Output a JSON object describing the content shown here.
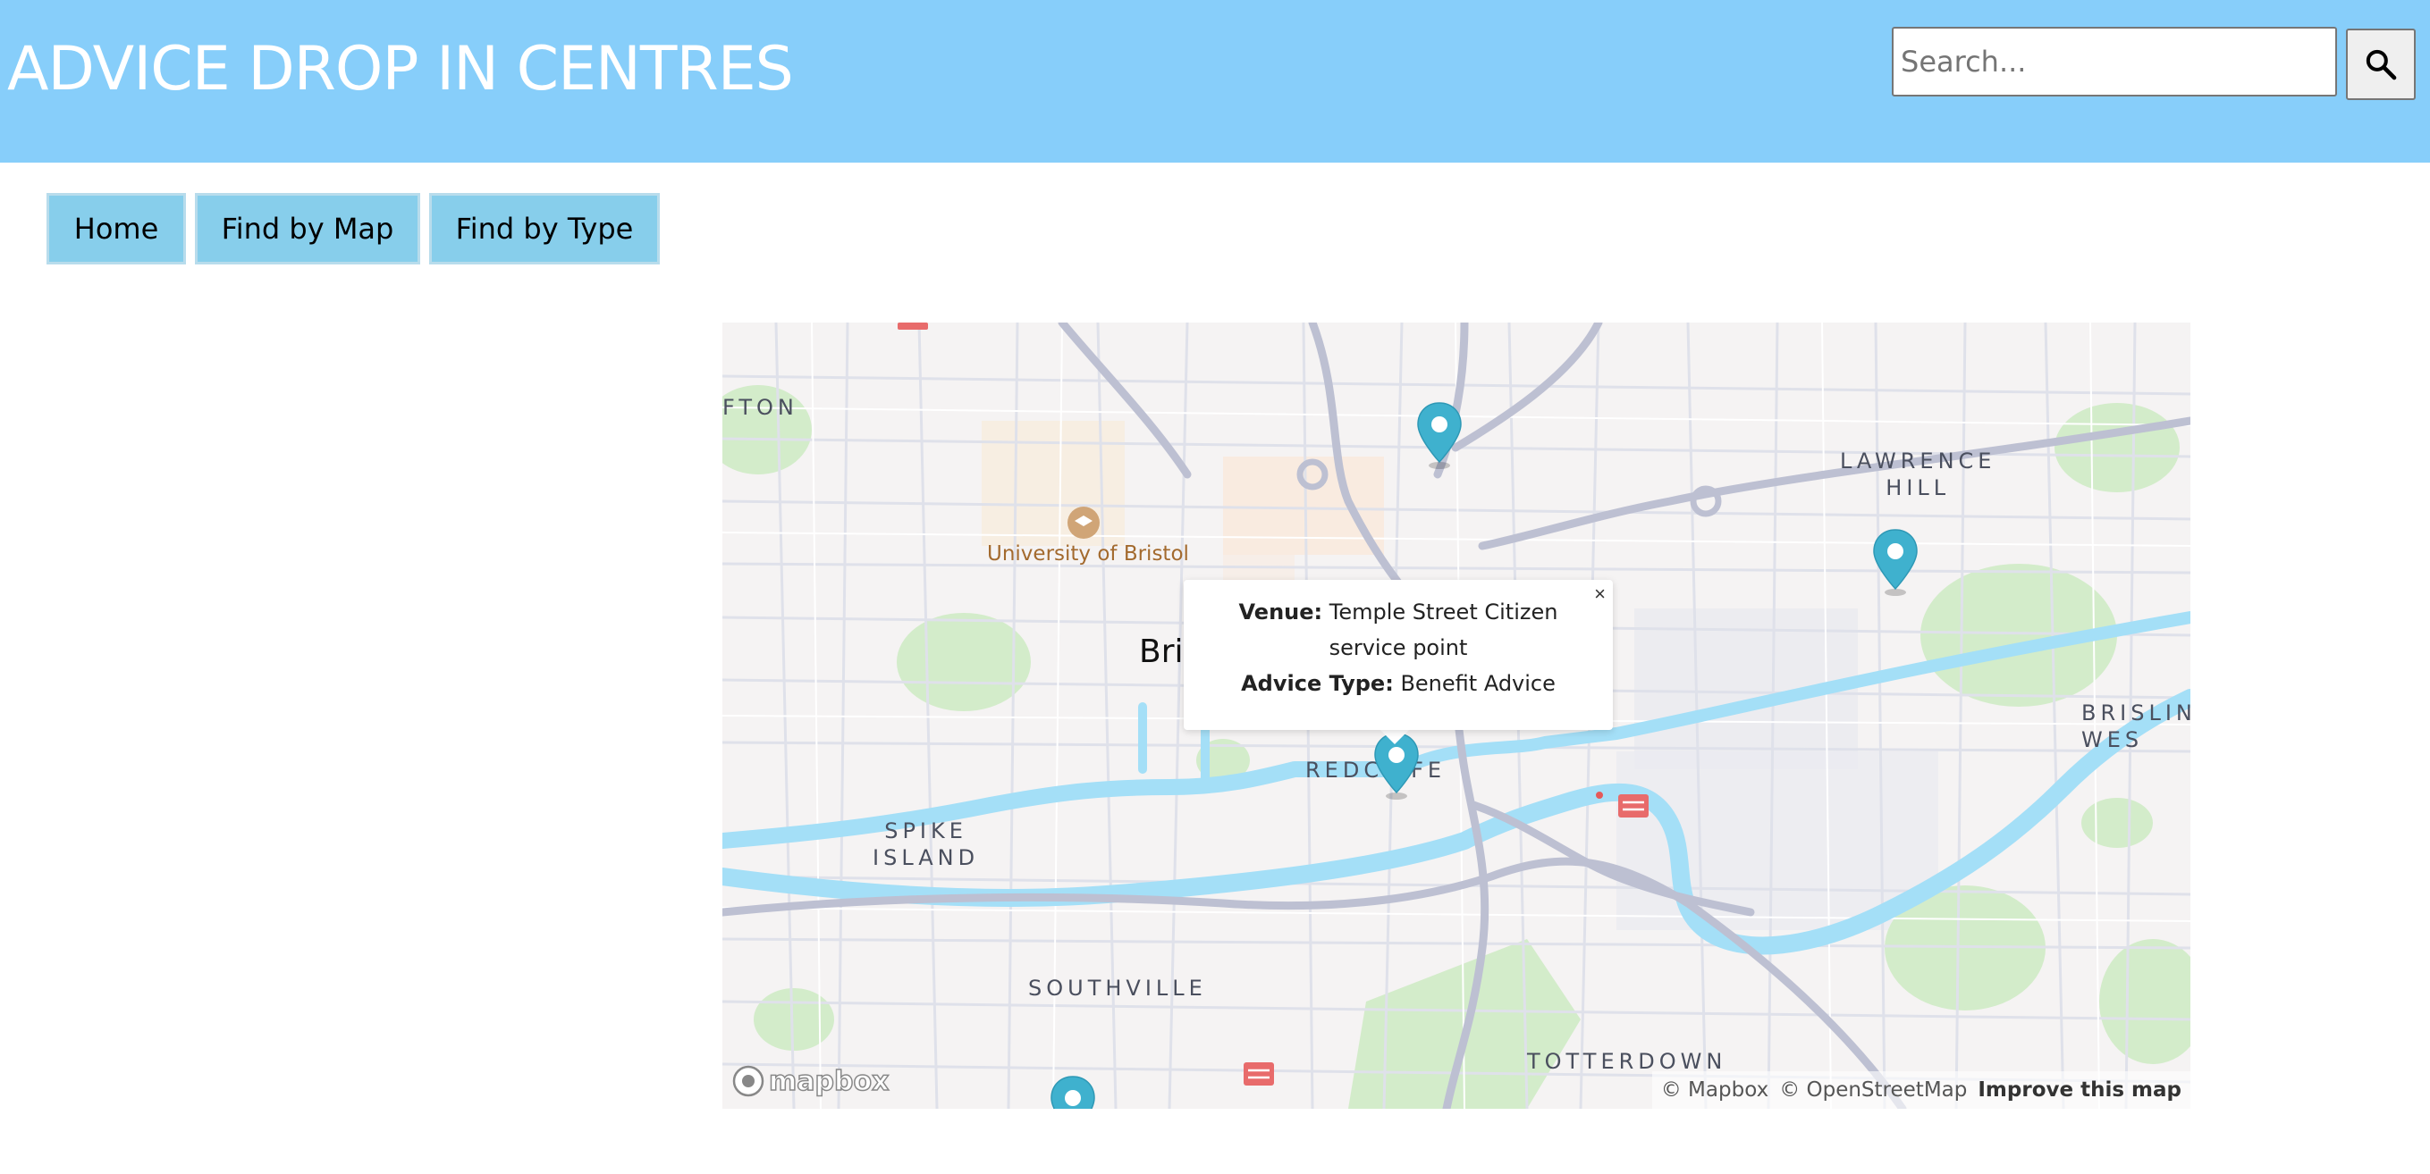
{
  "header": {
    "title": "ADVICE DROP IN CENTRES",
    "search": {
      "placeholder": "Search...",
      "value": ""
    },
    "search_button_icon": "search-icon"
  },
  "nav": {
    "home": "Home",
    "find_by_map": "Find by Map",
    "find_by_type": "Find by Type"
  },
  "map": {
    "labels": {
      "fton": "FTON",
      "lawrence_hill": "LAWRENCE\nHILL",
      "university": "University of Bristol",
      "city": "Bri",
      "redcliffe": "REDCL  FE",
      "spike_island": "SPIKE\nISLAND",
      "brislington": "BRISLIN\nWES",
      "southville": "SOUTHVILLE",
      "totterdown": "TOTTERDOWN"
    },
    "popup": {
      "close": "×",
      "venue_label": "Venue:",
      "venue_value": "Temple Street Citizen service point",
      "type_label": "Advice Type:",
      "type_value": "Benefit Advice"
    },
    "attribution": {
      "mapbox": "© Mapbox",
      "osm": "© OpenStreetMap",
      "improve": "Improve this map"
    },
    "logo": "mapbox",
    "colors": {
      "water": "#7fd3f7",
      "park": "#bfe3b4",
      "road_major": "#a9aec6",
      "road_minor": "#ffffff",
      "marker": "#3fb1ce"
    }
  }
}
